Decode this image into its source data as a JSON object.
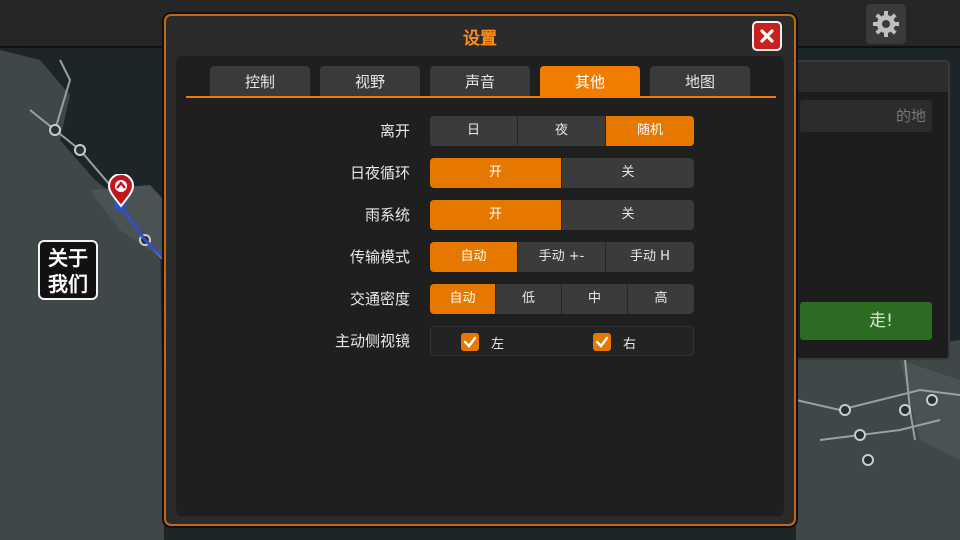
{
  "dialog": {
    "title": "设置",
    "tabs": [
      {
        "label": "控制",
        "active": false
      },
      {
        "label": "视野",
        "active": false
      },
      {
        "label": "声音",
        "active": false
      },
      {
        "label": "其他",
        "active": true
      },
      {
        "label": "地图",
        "active": false
      }
    ]
  },
  "settings": {
    "leave": {
      "label": "离开",
      "options": [
        "日",
        "夜",
        "随机"
      ],
      "selected": "随机"
    },
    "day_night_cycle": {
      "label": "日夜循环",
      "options": [
        "开",
        "关"
      ],
      "selected": "开"
    },
    "rain_system": {
      "label": "雨系统",
      "options": [
        "开",
        "关"
      ],
      "selected": "开"
    },
    "transmission": {
      "label": "传输模式",
      "options": [
        "自动",
        "手动 +-",
        "手动 H"
      ],
      "selected": "自动"
    },
    "traffic_density": {
      "label": "交通密度",
      "options": [
        "自动",
        "低",
        "中",
        "高"
      ],
      "selected": "自动"
    },
    "side_mirrors": {
      "label": "主动侧视镜",
      "left_label": "左",
      "left_checked": true,
      "right_label": "右",
      "right_checked": true
    }
  },
  "background": {
    "about_us_line1": "关于",
    "about_us_line2": "我们",
    "destination_placeholder": "的地",
    "go_label": "走!"
  },
  "colors": {
    "accent": "#f07d00",
    "dialog_border": "#c06a15",
    "close_red": "#c8201e",
    "go_green": "#2c6b22"
  },
  "icons": [
    "close-icon",
    "gear-icon",
    "checkmark-icon",
    "map-pin-icon"
  ]
}
